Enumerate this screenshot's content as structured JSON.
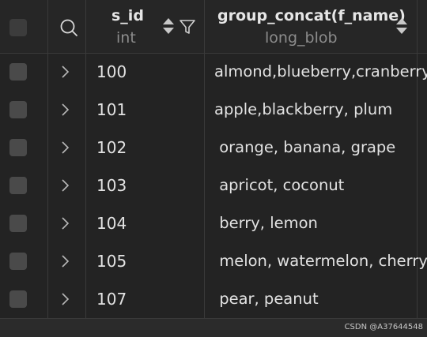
{
  "columns": [
    {
      "name": "s_id",
      "type": "int"
    },
    {
      "name": "group_concat(f_name)",
      "type": "long_blob"
    }
  ],
  "rows": [
    {
      "s_id": "100",
      "f_name": "almond,blueberry,cranberry"
    },
    {
      "s_id": "101",
      "f_name": "apple,blackberry, plum"
    },
    {
      "s_id": "102",
      "f_name": " orange, banana, grape"
    },
    {
      "s_id": "103",
      "f_name": " apricot, coconut"
    },
    {
      "s_id": "104",
      "f_name": " berry, lemon"
    },
    {
      "s_id": "105",
      "f_name": " melon, watermelon, cherry"
    },
    {
      "s_id": "107",
      "f_name": " pear, peanut"
    }
  ],
  "watermark": "CSDN @A37644548",
  "icons": {
    "search": "search-icon",
    "sort": "sort-icon",
    "filter": "filter-icon",
    "expand": "chevron-right-icon"
  },
  "colors": {
    "background": "#232323",
    "header": "#262626",
    "text": "#e2e2e2",
    "muted": "#8c8c8c"
  }
}
